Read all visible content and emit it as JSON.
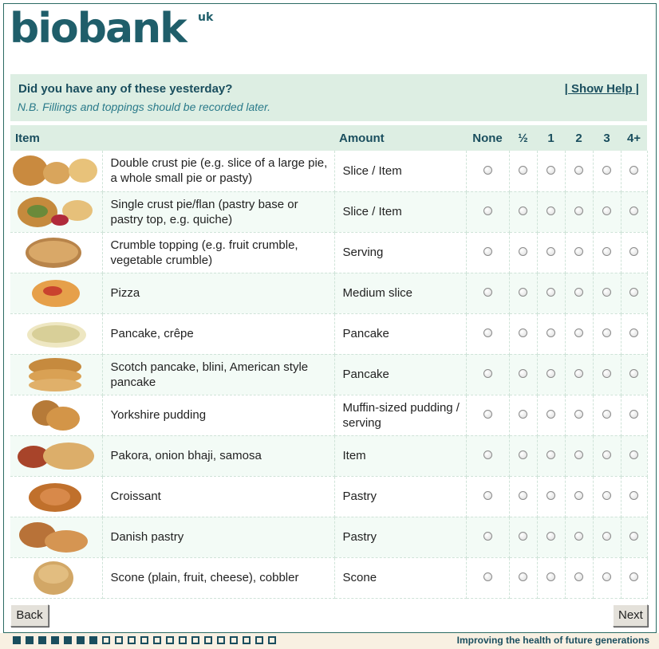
{
  "brand": {
    "logo_text": "biobank",
    "logo_suffix": "uk",
    "color": "#1f5e6a"
  },
  "question": {
    "title": "Did you have any of these yesterday?",
    "note": "N.B. Fillings and toppings should be recorded later.",
    "help_link": "| Show Help |"
  },
  "table": {
    "headers": {
      "item": "Item",
      "amount": "Amount",
      "none": "None",
      "half": "½",
      "one": "1",
      "two": "2",
      "three": "3",
      "four_plus": "4+"
    },
    "rows": [
      {
        "name": "Double crust pie (e.g. slice of a large pie, a whole small pie or pasty)",
        "amount": "Slice / Item",
        "icon": "pie-image"
      },
      {
        "name": "Single crust pie/flan (pastry base or pastry top, e.g. quiche)",
        "amount": "Slice / Item",
        "icon": "flan-image"
      },
      {
        "name": "Crumble topping (e.g. fruit crumble, vegetable crumble)",
        "amount": "Serving",
        "icon": "crumble-image"
      },
      {
        "name": "Pizza",
        "amount": "Medium slice",
        "icon": "pizza-image"
      },
      {
        "name": "Pancake, crêpe",
        "amount": "Pancake",
        "icon": "crepe-image"
      },
      {
        "name": "Scotch pancake, blini, American style pancake",
        "amount": "Pancake",
        "icon": "pancake-stack-image"
      },
      {
        "name": "Yorkshire pudding",
        "amount": "Muffin-sized pudding / serving",
        "icon": "yorkshire-pudding-image"
      },
      {
        "name": "Pakora, onion bhaji, samosa",
        "amount": "Item",
        "icon": "samosa-image"
      },
      {
        "name": "Croissant",
        "amount": "Pastry",
        "icon": "croissant-image"
      },
      {
        "name": "Danish pastry",
        "amount": "Pastry",
        "icon": "danish-image"
      },
      {
        "name": "Scone (plain, fruit, cheese), cobbler",
        "amount": "Scone",
        "icon": "scone-image"
      }
    ]
  },
  "nav": {
    "back": "Back",
    "next": "Next"
  },
  "footer": {
    "tagline": "Improving the health of future generations",
    "progress_done": 7,
    "progress_total": 21
  },
  "colors": {
    "header_bg": "#ddeee3",
    "accent": "#1a4e5e",
    "note": "#2a7a8a"
  }
}
